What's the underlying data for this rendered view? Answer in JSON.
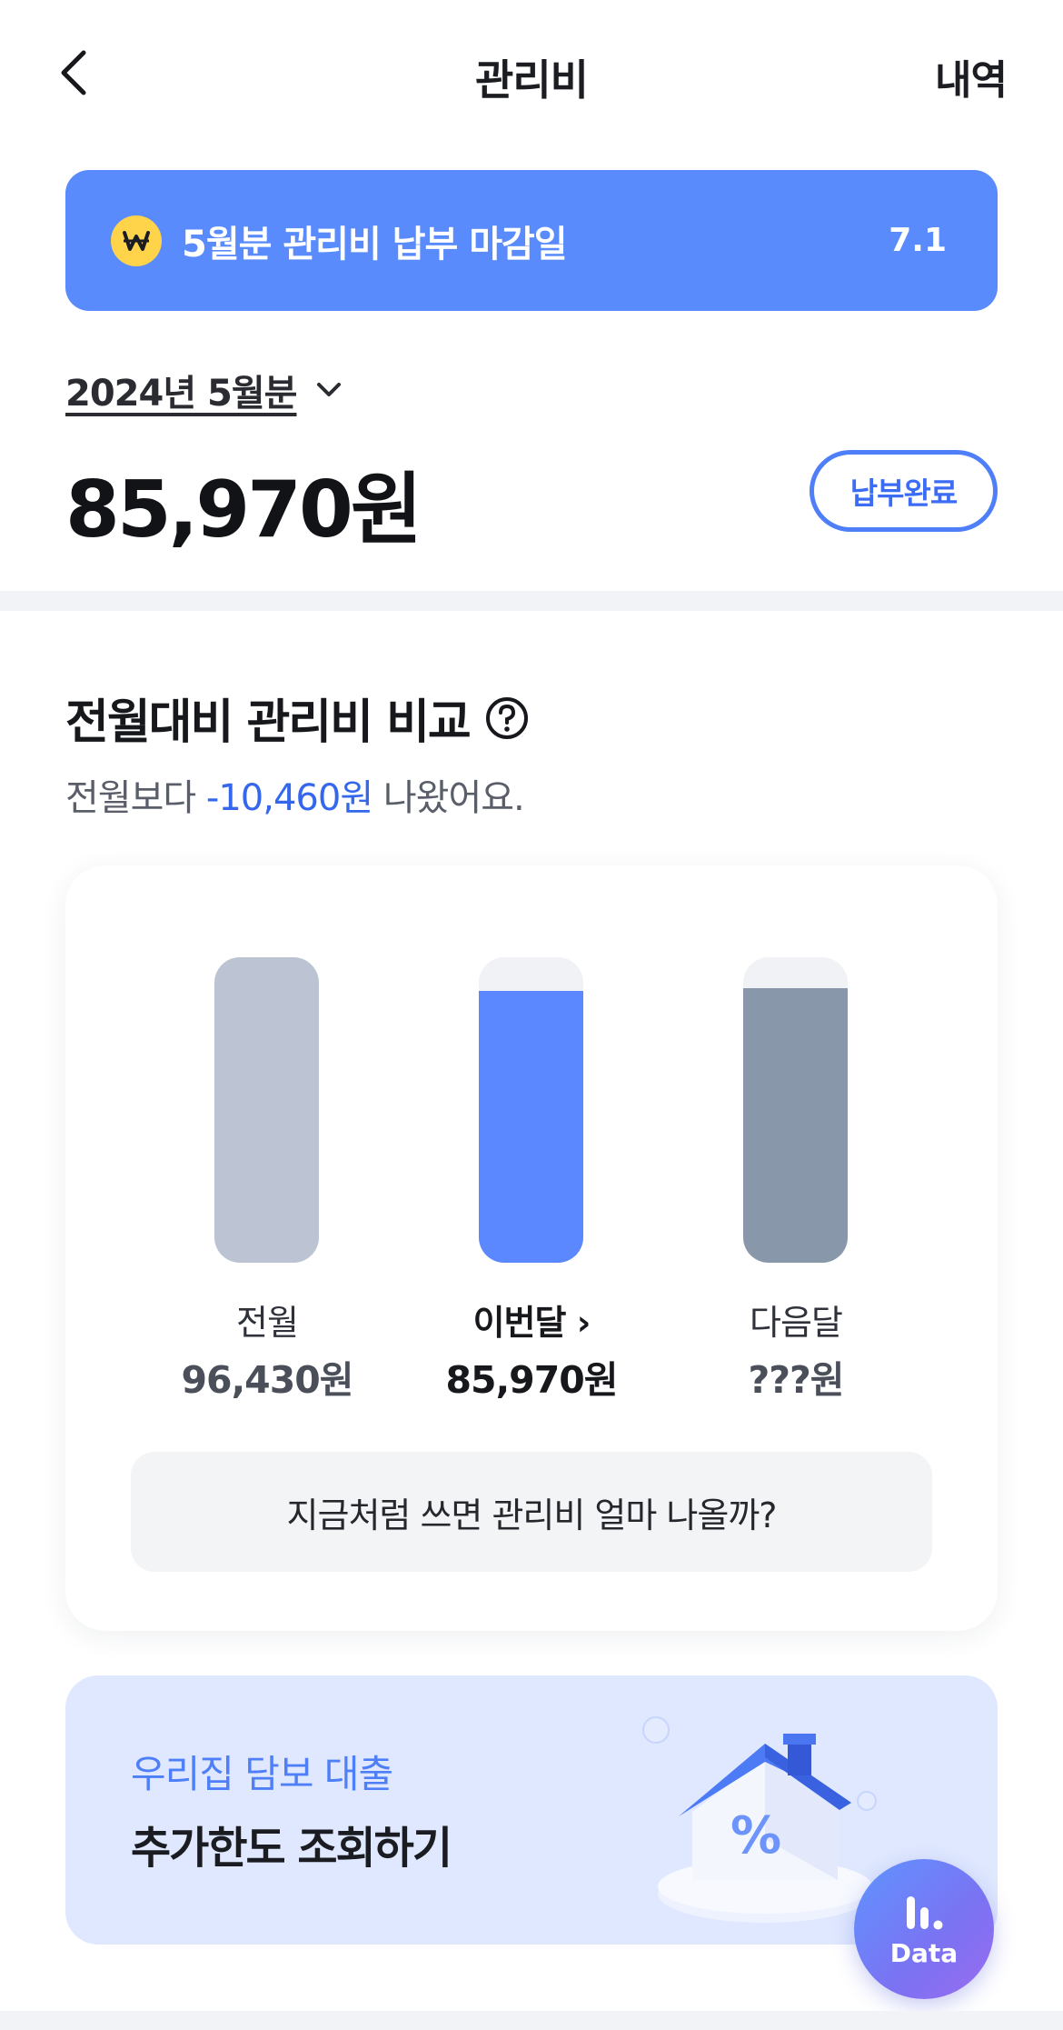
{
  "header": {
    "back_icon": "chevron-left-icon",
    "title": "관리비",
    "history_label": "내역"
  },
  "notice": {
    "icon": "won-coin-icon",
    "text": "5월분 관리비 납부 마감일",
    "date": "7.1",
    "bg_color": "#598bfc"
  },
  "bill": {
    "period": "2024년 5월분",
    "amount": "85,970원",
    "status": "납부완료"
  },
  "comparison": {
    "title": "전월대비 관리비 비교",
    "subtitle_prefix": "전월보다",
    "difference": "-10,460원",
    "subtitle_suffix": "나왔어요.",
    "predict_button": "지금처럼 쓰면 관리비 얼마 나올까?"
  },
  "chart_data": {
    "type": "bar",
    "categories": [
      "전월",
      "이번달",
      "다음달"
    ],
    "values": [
      96430,
      85970,
      null
    ],
    "value_labels": [
      "96,430원",
      "85,970원",
      "???원"
    ],
    "current_suffix": "›",
    "colors": [
      "#bcc4d4",
      "#5b88ff",
      "#8897aa"
    ],
    "fill_levels": [
      1.0,
      0.89,
      0.9
    ]
  },
  "promo": {
    "subtitle": "우리집 담보 대출",
    "title": "추가한도 조회하기",
    "illustration": "house-percent-icon"
  },
  "fab": {
    "label": "Data",
    "icon": "bar-chart-icon"
  }
}
